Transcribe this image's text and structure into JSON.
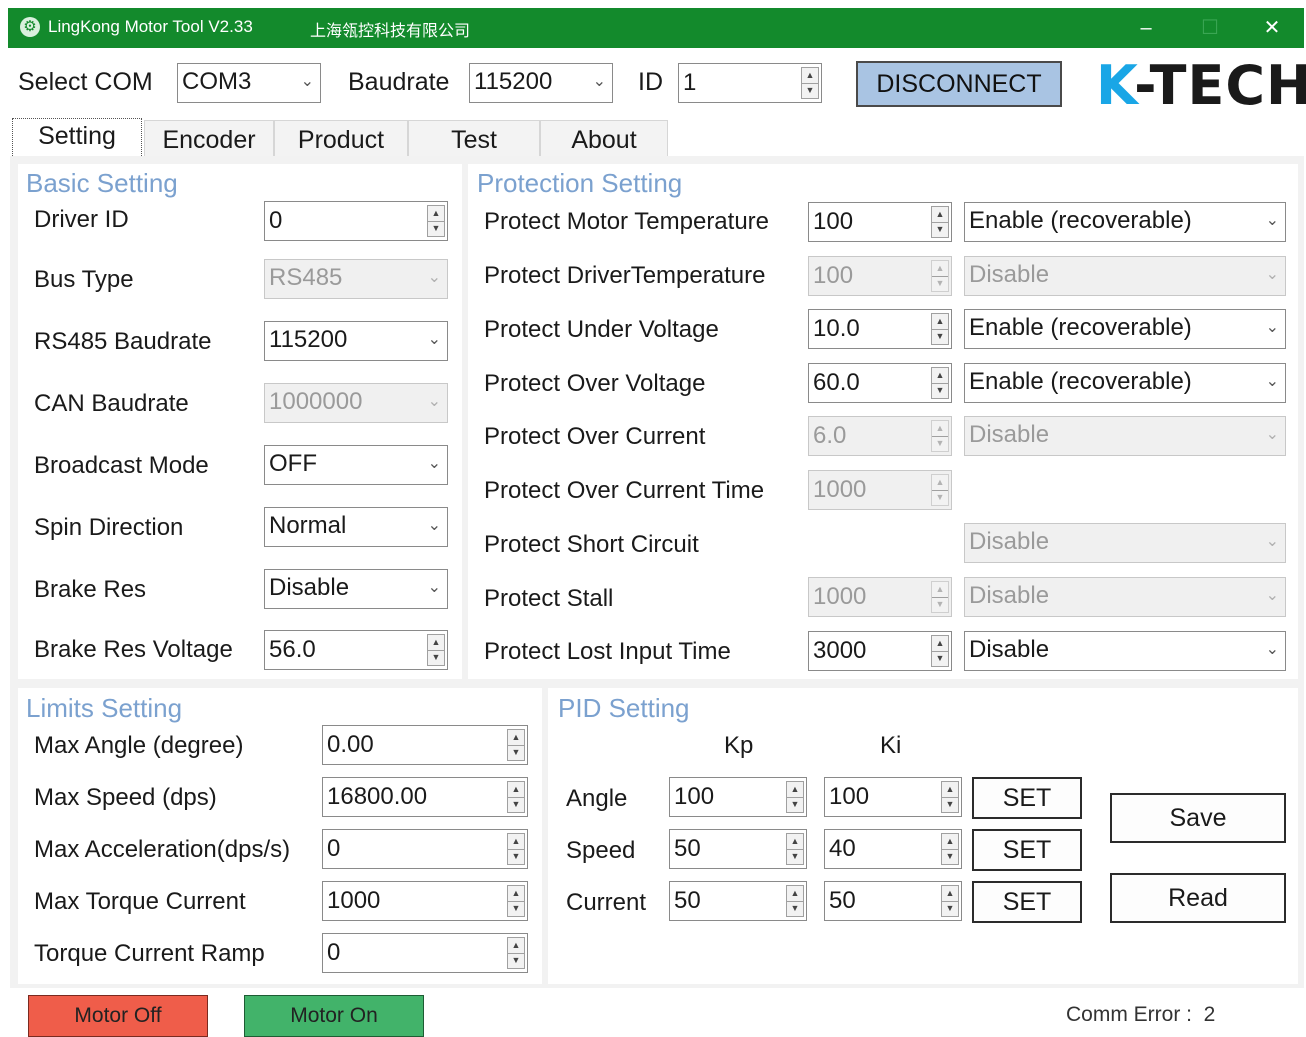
{
  "window": {
    "title": "LingKong Motor Tool V2.33",
    "company": "上海瓴控科技有限公司",
    "minimize_icon": "minimize-icon",
    "maximize_icon": "maximize-icon",
    "close_icon": "close-icon"
  },
  "toolbar": {
    "select_com_label": "Select COM",
    "com_value": "COM3",
    "baudrate_label": "Baudrate",
    "baudrate_value": "115200",
    "id_label": "ID",
    "id_value": "1",
    "disconnect_label": "DISCONNECT",
    "logo_k": "K",
    "logo_rest": "-TECH",
    "button_color": "#a9c4e3"
  },
  "tabs": [
    "Setting",
    "Encoder",
    "Product",
    "Test",
    "About"
  ],
  "active_tab": "Setting",
  "basic": {
    "title": "Basic Setting",
    "driver_id_label": "Driver ID",
    "driver_id": "0",
    "bus_type_label": "Bus Type",
    "bus_type": "RS485",
    "rs485_baud_label": "RS485 Baudrate",
    "rs485_baud": "115200",
    "can_baud_label": "CAN Baudrate",
    "can_baud": "1000000",
    "broadcast_label": "Broadcast Mode",
    "broadcast": "OFF",
    "spin_label": "Spin Direction",
    "spin": "Normal",
    "brake_res_label": "Brake Res",
    "brake_res": "Disable",
    "brake_voltage_label": "Brake Res Voltage",
    "brake_voltage": "56.0"
  },
  "protection": {
    "title": "Protection Setting",
    "rows": [
      {
        "label": "Protect Motor Temperature",
        "value": "100",
        "mode": "Enable (recoverable)"
      },
      {
        "label": "Protect DriverTemperature",
        "value": "100",
        "mode": "Disable"
      },
      {
        "label": "Protect Under Voltage",
        "value": "10.0",
        "mode": "Enable (recoverable)"
      },
      {
        "label": "Protect Over Voltage",
        "value": "60.0",
        "mode": "Enable (recoverable)"
      },
      {
        "label": "Protect Over Current",
        "value": "6.0",
        "mode": "Disable"
      },
      {
        "label": "Protect Over Current Time",
        "value": "1000"
      },
      {
        "label": "Protect Short Circuit",
        "mode": "Disable"
      },
      {
        "label": "Protect Stall",
        "value": "1000",
        "mode": "Disable"
      },
      {
        "label": "Protect Lost Input Time",
        "value": "3000",
        "mode": "Disable"
      }
    ]
  },
  "limits": {
    "title": "Limits Setting",
    "rows": [
      {
        "label": "Max Angle (degree)",
        "value": "0.00"
      },
      {
        "label": "Max Speed (dps)",
        "value": "16800.00"
      },
      {
        "label": "Max Acceleration(dps/s)",
        "value": "0"
      },
      {
        "label": "Max Torque Current",
        "value": "1000"
      },
      {
        "label": "Torque Current Ramp",
        "value": "0"
      }
    ]
  },
  "pid": {
    "title": "PID Setting",
    "kp_header": "Kp",
    "ki_header": "Ki",
    "rows": [
      {
        "label": "Angle",
        "kp": "100",
        "ki": "100",
        "set": "SET"
      },
      {
        "label": "Speed",
        "kp": "50",
        "ki": "40",
        "set": "SET"
      },
      {
        "label": "Current",
        "kp": "50",
        "ki": "50",
        "set": "SET"
      }
    ],
    "save_label": "Save",
    "read_label": "Read"
  },
  "footer": {
    "motor_off": "Motor Off",
    "motor_on": "Motor On",
    "comm_error_label": "Comm Error :",
    "comm_error_value": "2",
    "motor_off_color": "#ef5d4a",
    "motor_on_color": "#42b36a"
  }
}
